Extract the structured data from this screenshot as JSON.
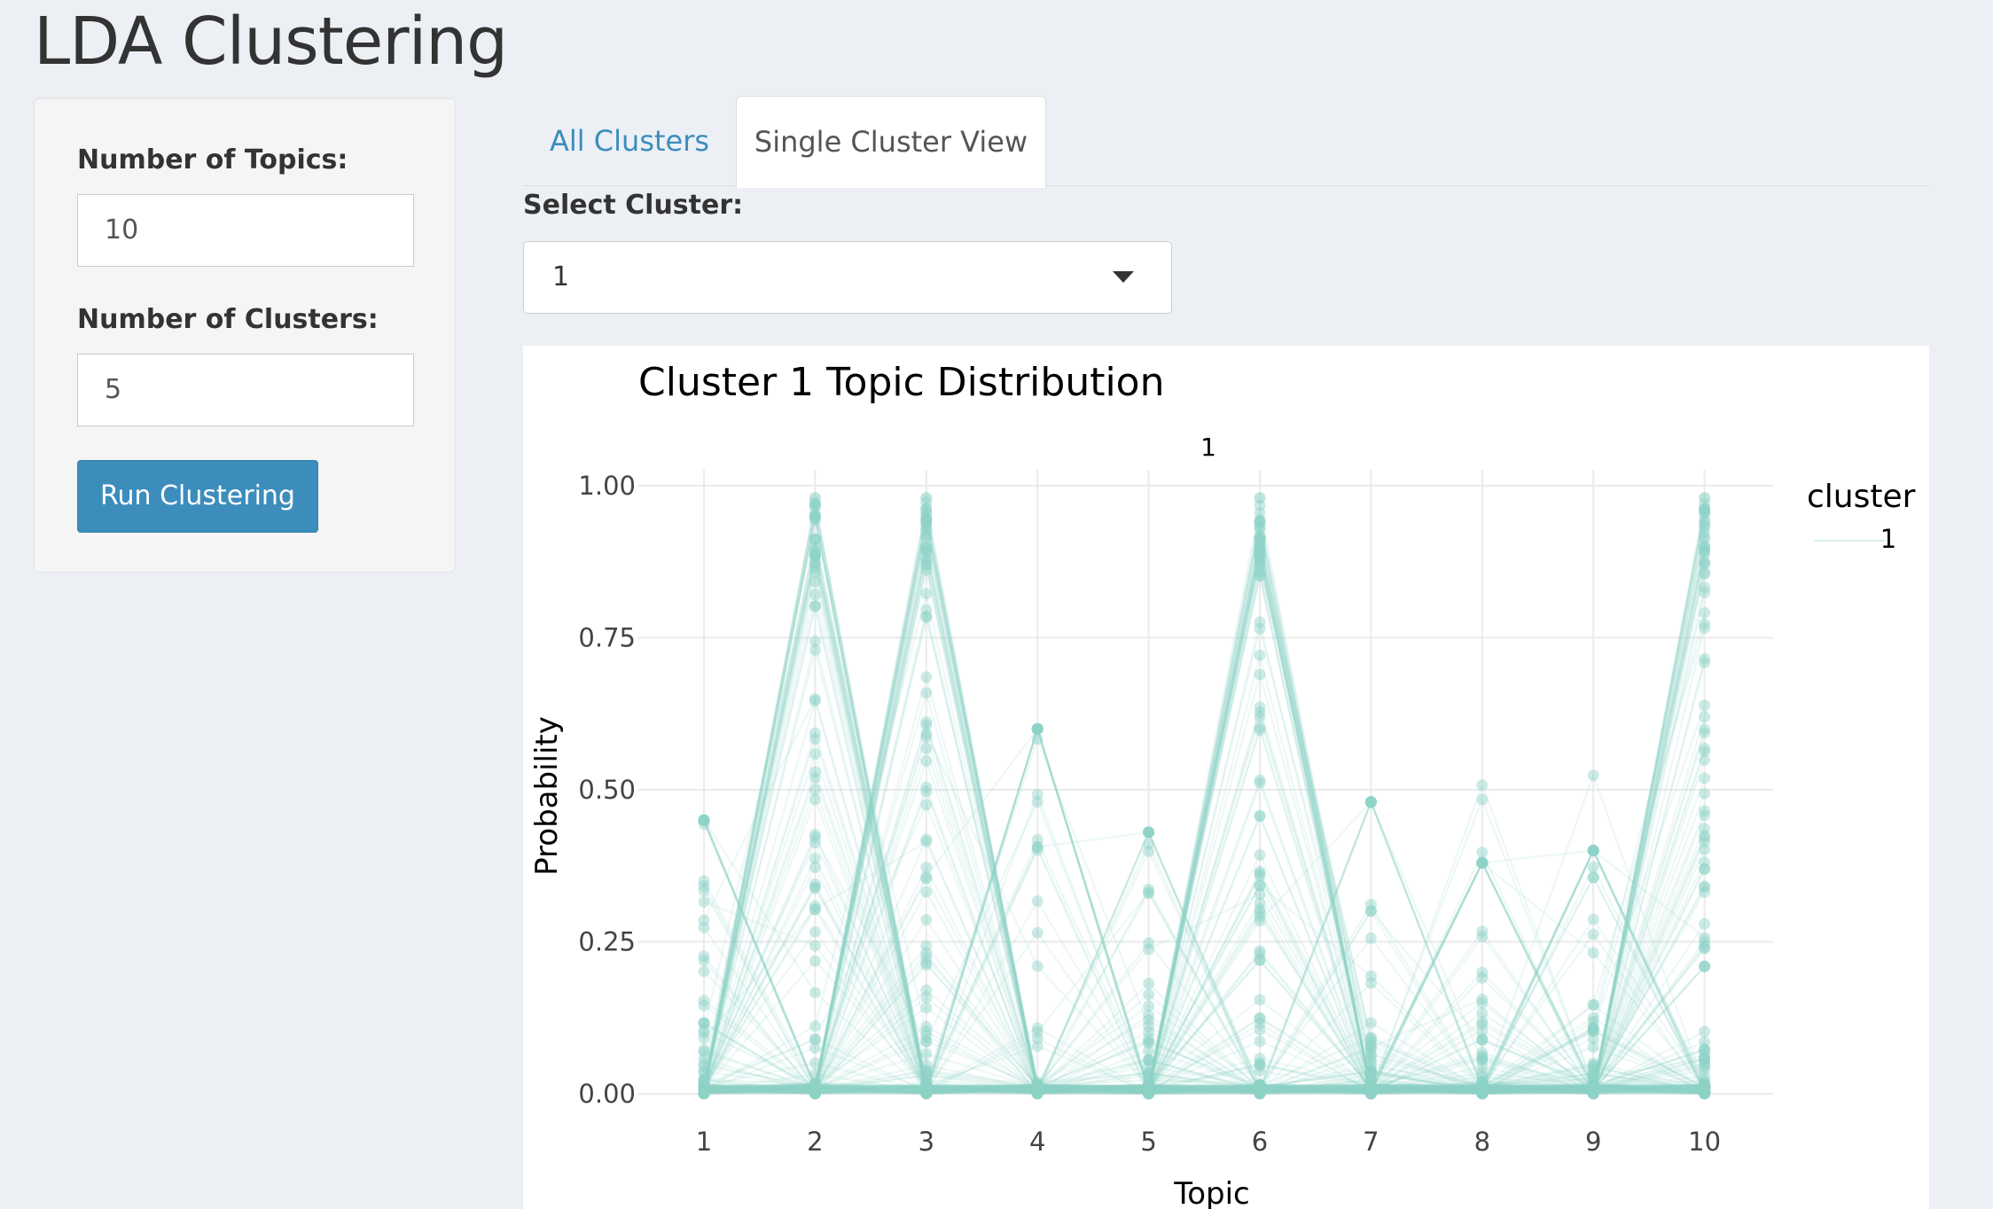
{
  "page": {
    "title": "LDA Clustering"
  },
  "sidebar": {
    "topics_label": "Number of Topics:",
    "topics_value": "10",
    "clusters_label": "Number of Clusters:",
    "clusters_value": "5",
    "run_button_label": "Run Clustering"
  },
  "tabs": [
    {
      "label": "All Clusters",
      "active": false
    },
    {
      "label": "Single Cluster View",
      "active": true
    }
  ],
  "select": {
    "label": "Select Cluster:",
    "value": "1"
  },
  "colors": {
    "accent": "#3c8dbc",
    "series": "#8dd3c7",
    "background": "#ecf0f5"
  },
  "chart_data": {
    "type": "line",
    "title": "Cluster 1 Topic Distribution",
    "facet_label": "1",
    "xlabel": "Topic",
    "ylabel": "Probability",
    "x": [
      1,
      2,
      3,
      4,
      5,
      6,
      7,
      8,
      9,
      10
    ],
    "x_tick_labels": [
      "1",
      "2",
      "3",
      "4",
      "5",
      "6",
      "7",
      "8",
      "9",
      "10"
    ],
    "y_ticks": [
      0.0,
      0.25,
      0.5,
      0.75,
      1.0
    ],
    "y_tick_labels": [
      "0.00",
      "0.25",
      "0.50",
      "0.75",
      "1.00"
    ],
    "ylim": [
      0,
      1.0
    ],
    "grid": true,
    "legend": {
      "title": "cluster",
      "entries": [
        "1"
      ],
      "placement": "right"
    },
    "topic_max_probability": [
      0.45,
      0.98,
      0.98,
      0.6,
      0.43,
      0.98,
      0.48,
      0.38,
      0.4,
      0.98
    ],
    "series_style": "many semi-transparent lines, one per document, each concentrated on a single topic"
  }
}
